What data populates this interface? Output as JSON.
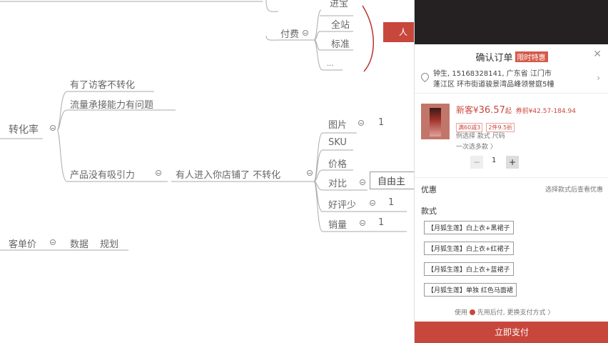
{
  "mindmap": {
    "payment_label": "付费",
    "payment_items": [
      "进宝",
      "全站",
      "标准",
      "..."
    ],
    "tab_partial": "人",
    "conversion_rate": "转化率",
    "visitors_no_convert": "有了访客不转化",
    "traffic_problem": "流量承接能力有问题",
    "product_no_attraction": "产品没有吸引力",
    "entered_store": "有人进入你店铺了 不转化",
    "factors": [
      {
        "label": "图片",
        "count": "1"
      },
      {
        "label": "SKU",
        "count": ""
      },
      {
        "label": "价格",
        "count": ""
      },
      {
        "label": "对比",
        "count": ""
      },
      {
        "label": "好评少",
        "count": "1"
      },
      {
        "label": "销量",
        "count": "1"
      }
    ],
    "compare_box": "自由主",
    "avg_order": "客单价",
    "data": "数据",
    "plan": "规划"
  },
  "order": {
    "title": "确认订单",
    "badge": "限时特惠",
    "address_line1": "钟生, 15168328141, 广东省 江门市",
    "address_line2": "蓬江区 环市街道骏景湾品峰领誉庭5幢",
    "price_prefix": "新客¥",
    "price": "36.57",
    "price_suffix": "起",
    "price_range": "券前¥42.57-184.94",
    "tag1": "满60减3",
    "tag2": "2件9.5折",
    "selected": "例选择 款式 尺码",
    "multi": "一次选多款 〉",
    "qty": "1",
    "discount_label": "优惠",
    "discount_hint": "选择款式后查看优惠",
    "style_label": "款式",
    "styles": [
      "【月狐生莲】白上衣+黑裙子",
      "【月狐生莲】白上衣+红裙子",
      "【月狐生莲】白上衣+蓝裙子",
      "【月狐生莲】单独 红色马面裙"
    ],
    "pay_note_pre": "使用",
    "pay_note_post": "先用后付, 更换支付方式 〉",
    "buy_button": "立即支付"
  },
  "colors": {
    "accent": "#c8473d",
    "panel_top": "#252021",
    "curve": "#b7312b"
  },
  "icons": {
    "close": "close-icon",
    "location": "location-pin-icon",
    "chevron": "chevron-right-icon"
  }
}
